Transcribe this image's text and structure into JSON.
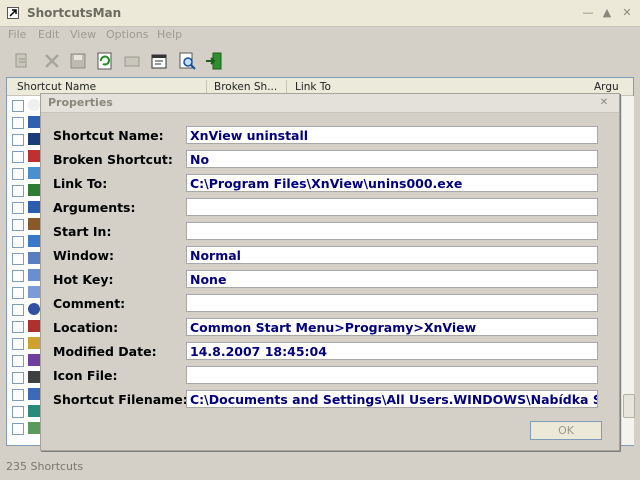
{
  "window": {
    "title": "ShortcutsMan"
  },
  "menu": [
    "File",
    "Edit",
    "View",
    "Options",
    "Help"
  ],
  "toolbar": [
    "scan-icon",
    "delete-icon",
    "save-icon",
    "refresh-icon",
    "fix-icon",
    "properties-icon",
    "search-icon",
    "exit-icon"
  ],
  "list": {
    "columns": [
      "Shortcut Name",
      "Broken Sh...",
      "Link To",
      "Argu"
    ]
  },
  "status": {
    "text": "235 Shortcuts"
  },
  "dialog": {
    "title": "Properties",
    "fields": [
      {
        "label": "Shortcut Name:",
        "value": "XnView uninstall"
      },
      {
        "label": "Broken Shortcut:",
        "value": "No"
      },
      {
        "label": "Link To:",
        "value": "C:\\Program Files\\XnView\\unins000.exe"
      },
      {
        "label": "Arguments:",
        "value": ""
      },
      {
        "label": "Start In:",
        "value": ""
      },
      {
        "label": "Window:",
        "value": "Normal"
      },
      {
        "label": "Hot Key:",
        "value": "None"
      },
      {
        "label": "Comment:",
        "value": ""
      },
      {
        "label": "Location:",
        "value": "Common Start Menu>Programy>XnView"
      },
      {
        "label": "Modified Date:",
        "value": "14.8.2007 18:45:04"
      },
      {
        "label": "Icon File:",
        "value": ""
      },
      {
        "label": "Shortcut Filename:",
        "value": "C:\\Documents and Settings\\All Users.WINDOWS\\Nabídka Start\\"
      }
    ],
    "ok_label": "OK"
  }
}
